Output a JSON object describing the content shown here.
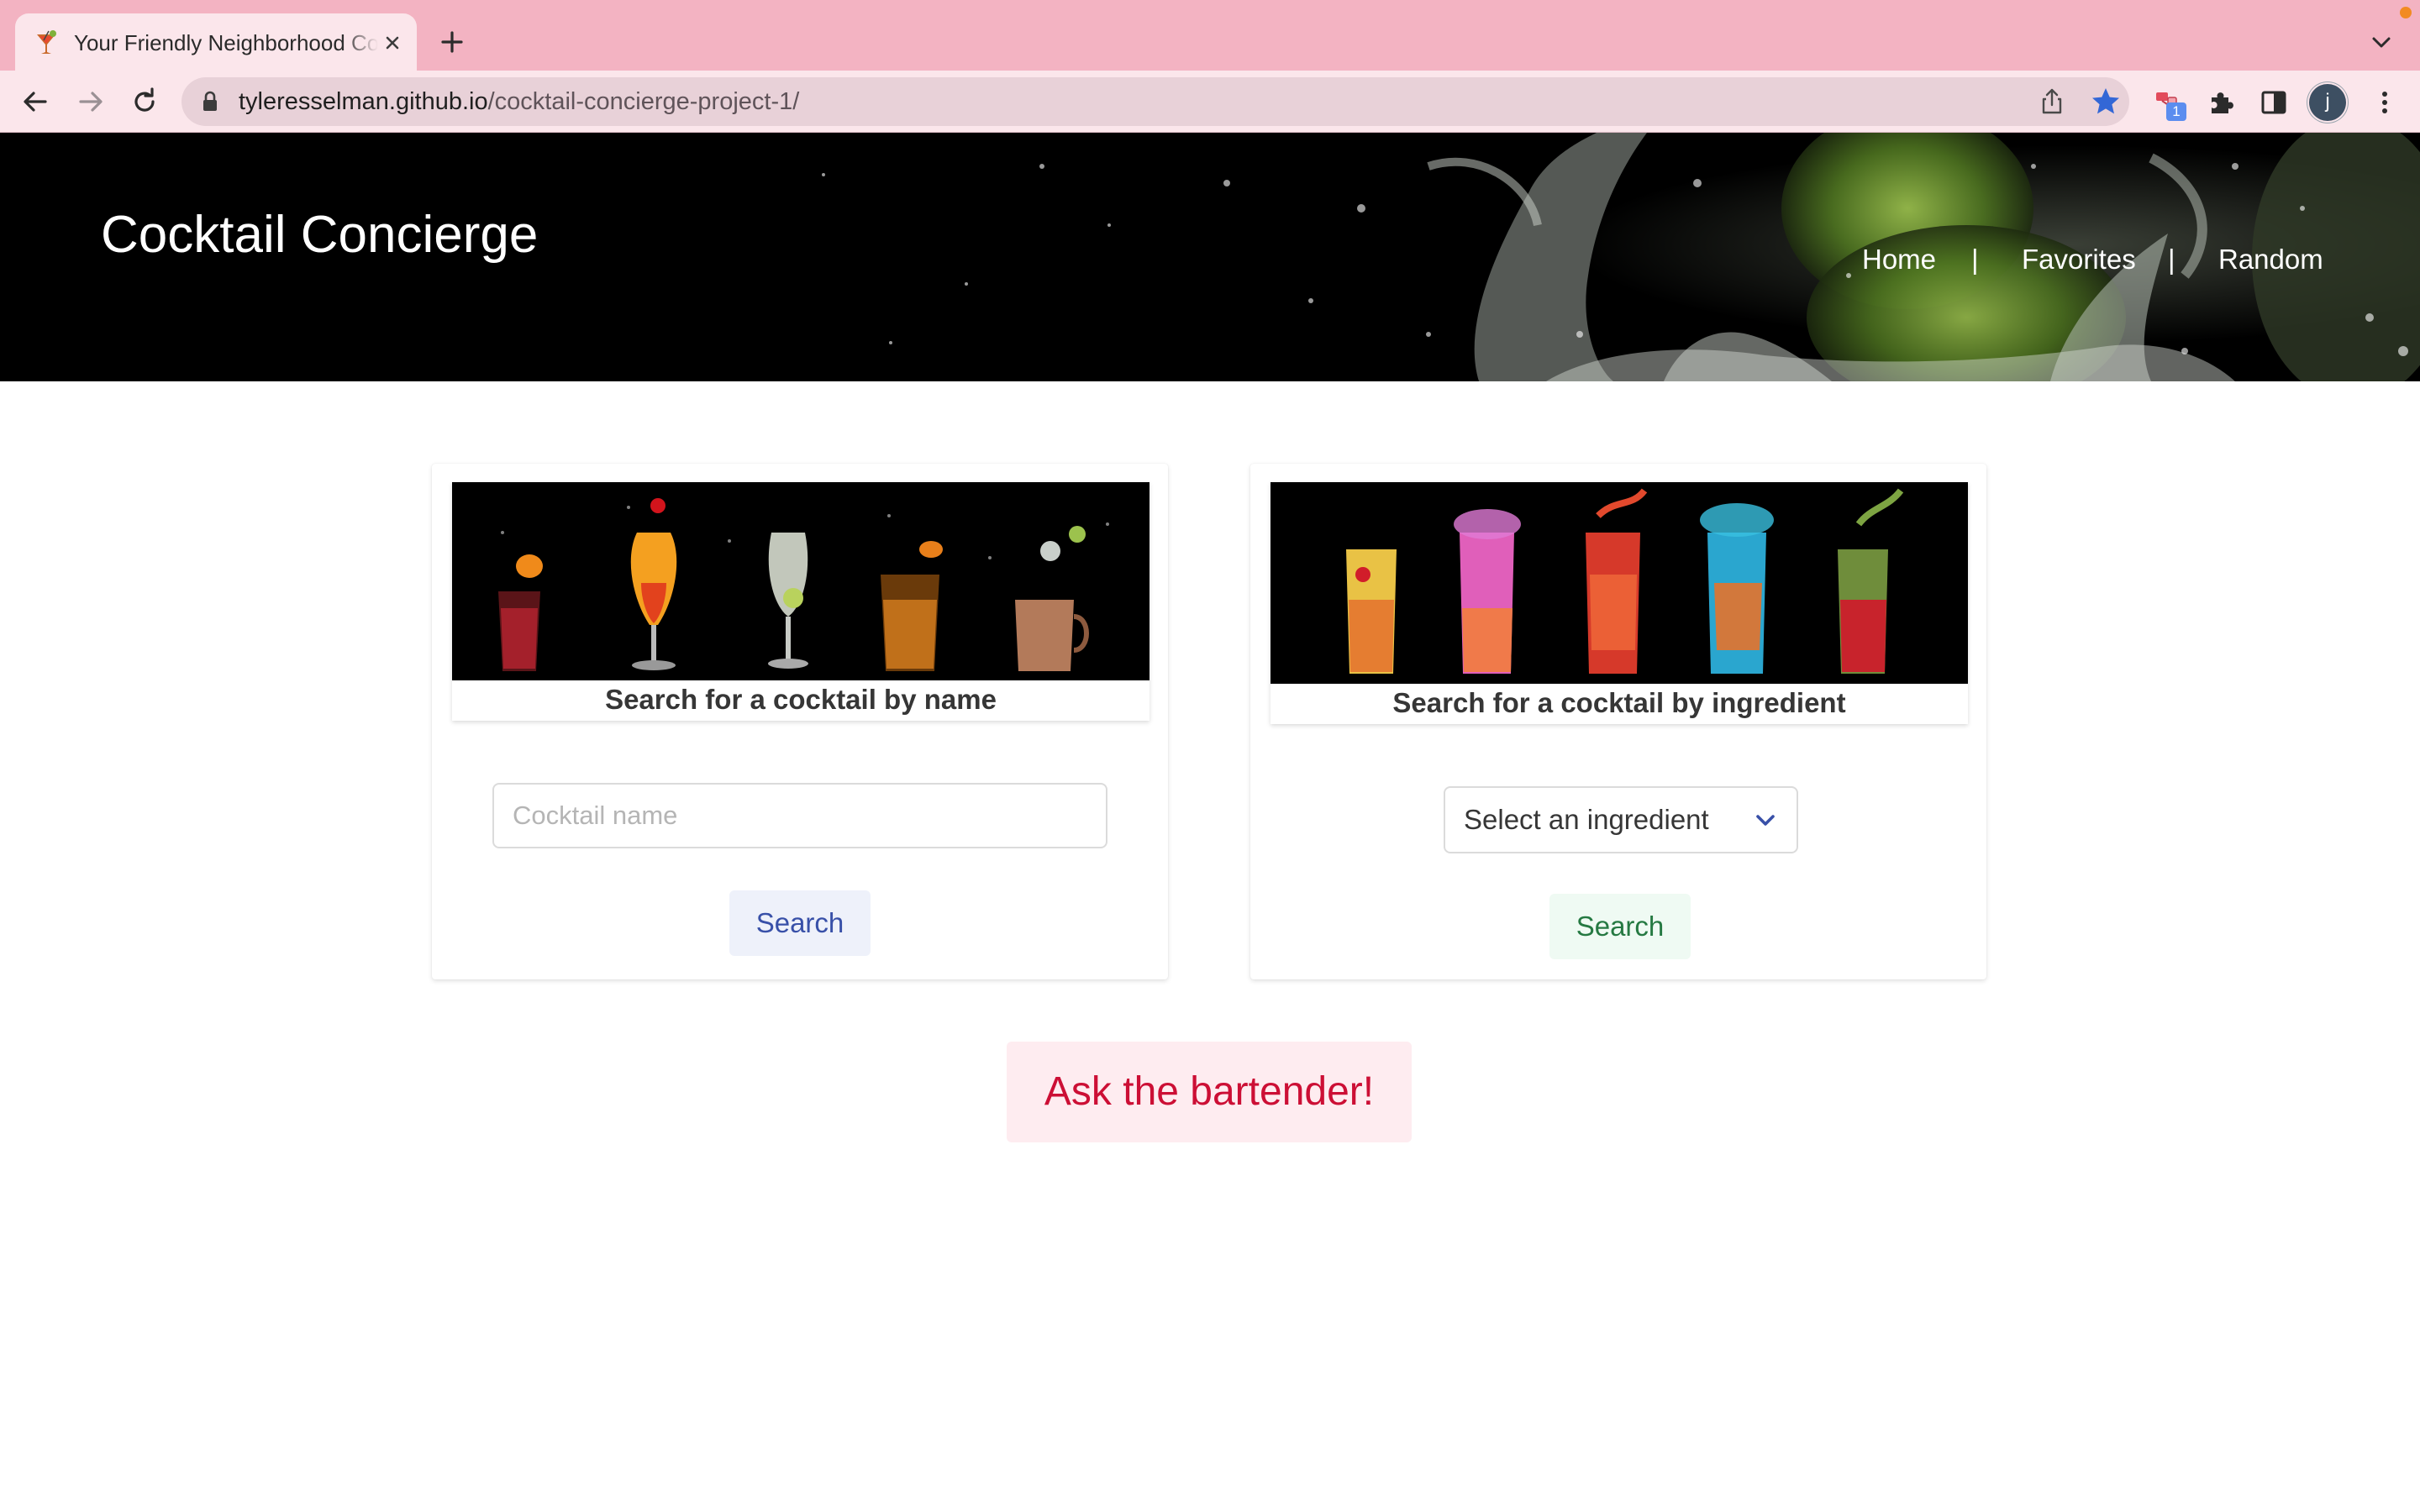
{
  "browser": {
    "tab": {
      "title": "Your Friendly Neighborhood Cocktail Concierge",
      "favicon": "cocktail-glass-icon"
    },
    "url": {
      "host": "tyleresselman.github.io",
      "path": "/cocktail-concierge-project-1/"
    },
    "profile_initial": "j",
    "extension_badge": "1",
    "colors": {
      "tab_strip": "#f3b3c2",
      "toolbar": "#fbe6eb",
      "omnibox": "#e8d1d8",
      "bookmark_star": "#3367d6"
    }
  },
  "header": {
    "title": "Cocktail Concierge",
    "nav": {
      "home": "Home",
      "separator": "|",
      "favorites": "Favorites",
      "random": "Random"
    }
  },
  "search_by_name": {
    "caption": "Search for a cocktail by name",
    "input_placeholder": "Cocktail name",
    "input_value": "",
    "button_label": "Search"
  },
  "search_by_ingredient": {
    "caption": "Search for a cocktail by ingredient",
    "select_value": "Select an ingredient",
    "button_label": "Search"
  },
  "ask_button": {
    "label": "Ask the bartender!"
  },
  "colors": {
    "link_blue": "#3850a8",
    "success_green": "#257942",
    "danger_red": "#cc0f35",
    "hero_bg": "#000000"
  }
}
